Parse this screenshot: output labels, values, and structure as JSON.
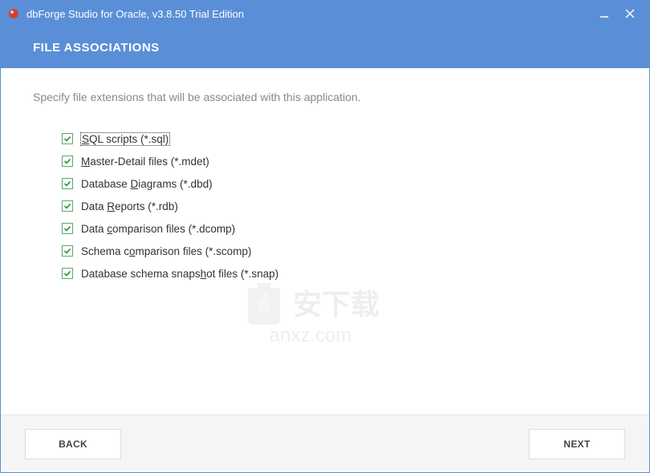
{
  "titlebar": {
    "title": "dbForge Studio for Oracle, v3.8.50 Trial Edition"
  },
  "header": {
    "title": "FILE ASSOCIATIONS"
  },
  "content": {
    "description": "Specify file extensions that will be associated with this application."
  },
  "checkboxes": [
    {
      "pre": "",
      "u": "S",
      "post": "QL scripts (*.sql)",
      "checked": true,
      "focused": true
    },
    {
      "pre": "",
      "u": "M",
      "post": "aster-Detail files (*.mdet)",
      "checked": true,
      "focused": false
    },
    {
      "pre": "Database ",
      "u": "D",
      "post": "iagrams (*.dbd)",
      "checked": true,
      "focused": false
    },
    {
      "pre": "Data ",
      "u": "R",
      "post": "eports (*.rdb)",
      "checked": true,
      "focused": false
    },
    {
      "pre": "Data ",
      "u": "c",
      "post": "omparison files (*.dcomp)",
      "checked": true,
      "focused": false
    },
    {
      "pre": "Schema c",
      "u": "o",
      "post": "mparison files (*.scomp)",
      "checked": true,
      "focused": false
    },
    {
      "pre": "Database schema snaps",
      "u": "h",
      "post": "ot files (*.snap)",
      "checked": true,
      "focused": false
    }
  ],
  "footer": {
    "back": "BACK",
    "next": "NEXT"
  },
  "watermark": {
    "text": "安下载",
    "url": "anxz.com"
  }
}
